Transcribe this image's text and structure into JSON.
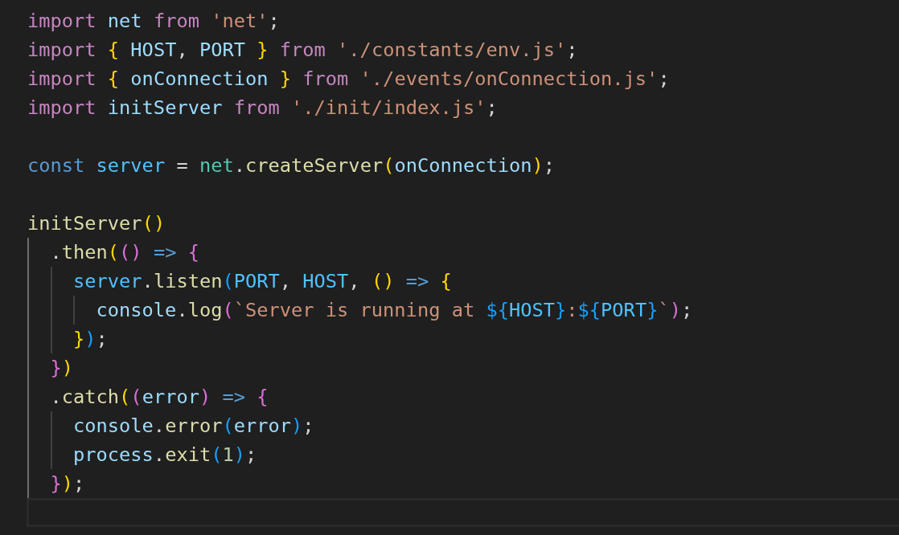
{
  "editor": {
    "lines": [
      {
        "kind": "code",
        "tokens": [
          {
            "kind": "keyword",
            "text": "import "
          },
          {
            "kind": "variable",
            "text": "net"
          },
          {
            "kind": "keyword",
            "text": " from "
          },
          {
            "kind": "string",
            "text": "'net'"
          },
          {
            "kind": "punct",
            "text": ";"
          }
        ]
      },
      {
        "kind": "code",
        "tokens": [
          {
            "kind": "keyword",
            "text": "import "
          },
          {
            "kind": "gold",
            "text": "{"
          },
          {
            "kind": "variable",
            "text": " HOST"
          },
          {
            "kind": "punct",
            "text": ", "
          },
          {
            "kind": "variable",
            "text": "PORT "
          },
          {
            "kind": "gold",
            "text": "}"
          },
          {
            "kind": "keyword",
            "text": " from "
          },
          {
            "kind": "string",
            "text": "'./constants/env.js'"
          },
          {
            "kind": "punct",
            "text": ";"
          }
        ]
      },
      {
        "kind": "code",
        "tokens": [
          {
            "kind": "keyword",
            "text": "import "
          },
          {
            "kind": "gold",
            "text": "{"
          },
          {
            "kind": "variable",
            "text": " onConnection "
          },
          {
            "kind": "gold",
            "text": "}"
          },
          {
            "kind": "keyword",
            "text": " from "
          },
          {
            "kind": "string",
            "text": "'./events/onConnection.js'"
          },
          {
            "kind": "punct",
            "text": ";"
          }
        ]
      },
      {
        "kind": "code",
        "tokens": [
          {
            "kind": "keyword",
            "text": "import "
          },
          {
            "kind": "variable",
            "text": "initServer"
          },
          {
            "kind": "keyword",
            "text": " from "
          },
          {
            "kind": "string",
            "text": "'./init/index.js'"
          },
          {
            "kind": "punct",
            "text": ";"
          }
        ]
      },
      {
        "kind": "blank"
      },
      {
        "kind": "code",
        "tokens": [
          {
            "kind": "storage",
            "text": "const "
          },
          {
            "kind": "constant",
            "text": "server"
          },
          {
            "kind": "punct",
            "text": " = "
          },
          {
            "kind": "type",
            "text": "net"
          },
          {
            "kind": "punct",
            "text": "."
          },
          {
            "kind": "function",
            "text": "createServer"
          },
          {
            "kind": "gold",
            "text": "("
          },
          {
            "kind": "variable",
            "text": "onConnection"
          },
          {
            "kind": "gold",
            "text": ")"
          },
          {
            "kind": "punct",
            "text": ";"
          }
        ]
      },
      {
        "kind": "blank"
      },
      {
        "kind": "code",
        "tokens": [
          {
            "kind": "function",
            "text": "initServer"
          },
          {
            "kind": "gold",
            "text": "()"
          }
        ]
      },
      {
        "kind": "code",
        "tokens": [
          {
            "kind": "punct",
            "text": "  ."
          },
          {
            "kind": "function",
            "text": "then"
          },
          {
            "kind": "gold",
            "text": "("
          },
          {
            "kind": "orchid",
            "text": "()"
          },
          {
            "kind": "storage",
            "text": " => "
          },
          {
            "kind": "orchid",
            "text": "{"
          }
        ]
      },
      {
        "kind": "code",
        "tokens": [
          {
            "kind": "constant",
            "text": "    server"
          },
          {
            "kind": "punct",
            "text": "."
          },
          {
            "kind": "function",
            "text": "listen"
          },
          {
            "kind": "blue",
            "text": "("
          },
          {
            "kind": "constant",
            "text": "PORT"
          },
          {
            "kind": "punct",
            "text": ", "
          },
          {
            "kind": "constant",
            "text": "HOST"
          },
          {
            "kind": "punct",
            "text": ", "
          },
          {
            "kind": "gold",
            "text": "()"
          },
          {
            "kind": "storage",
            "text": " => "
          },
          {
            "kind": "gold",
            "text": "{"
          }
        ]
      },
      {
        "kind": "code",
        "tokens": [
          {
            "kind": "variable",
            "text": "      console"
          },
          {
            "kind": "punct",
            "text": "."
          },
          {
            "kind": "function",
            "text": "log"
          },
          {
            "kind": "orchid",
            "text": "("
          },
          {
            "kind": "string",
            "text": "`Server is running at "
          },
          {
            "kind": "blue",
            "text": "${"
          },
          {
            "kind": "constant",
            "text": "HOST"
          },
          {
            "kind": "blue",
            "text": "}"
          },
          {
            "kind": "string",
            "text": ":"
          },
          {
            "kind": "blue",
            "text": "${"
          },
          {
            "kind": "constant",
            "text": "PORT"
          },
          {
            "kind": "blue",
            "text": "}"
          },
          {
            "kind": "string",
            "text": "`"
          },
          {
            "kind": "orchid",
            "text": ")"
          },
          {
            "kind": "punct",
            "text": ";"
          }
        ]
      },
      {
        "kind": "code",
        "tokens": [
          {
            "kind": "gold",
            "text": "    }"
          },
          {
            "kind": "blue",
            "text": ")"
          },
          {
            "kind": "punct",
            "text": ";"
          }
        ]
      },
      {
        "kind": "code",
        "tokens": [
          {
            "kind": "orchid",
            "text": "  }"
          },
          {
            "kind": "gold",
            "text": ")"
          }
        ]
      },
      {
        "kind": "code",
        "tokens": [
          {
            "kind": "punct",
            "text": "  ."
          },
          {
            "kind": "function",
            "text": "catch"
          },
          {
            "kind": "gold",
            "text": "("
          },
          {
            "kind": "orchid",
            "text": "("
          },
          {
            "kind": "variable",
            "text": "error"
          },
          {
            "kind": "orchid",
            "text": ")"
          },
          {
            "kind": "storage",
            "text": " => "
          },
          {
            "kind": "orchid",
            "text": "{"
          }
        ]
      },
      {
        "kind": "code",
        "tokens": [
          {
            "kind": "variable",
            "text": "    console"
          },
          {
            "kind": "punct",
            "text": "."
          },
          {
            "kind": "function",
            "text": "error"
          },
          {
            "kind": "blue",
            "text": "("
          },
          {
            "kind": "variable",
            "text": "error"
          },
          {
            "kind": "blue",
            "text": ")"
          },
          {
            "kind": "punct",
            "text": ";"
          }
        ]
      },
      {
        "kind": "code",
        "tokens": [
          {
            "kind": "variable",
            "text": "    process"
          },
          {
            "kind": "punct",
            "text": "."
          },
          {
            "kind": "function",
            "text": "exit"
          },
          {
            "kind": "blue",
            "text": "("
          },
          {
            "kind": "number",
            "text": "1"
          },
          {
            "kind": "blue",
            "text": ")"
          },
          {
            "kind": "punct",
            "text": ";"
          }
        ]
      },
      {
        "kind": "code",
        "tokens": [
          {
            "kind": "orchid",
            "text": "  }"
          },
          {
            "kind": "gold",
            "text": ")"
          },
          {
            "kind": "punct",
            "text": ";"
          }
        ]
      },
      {
        "kind": "current"
      }
    ]
  }
}
